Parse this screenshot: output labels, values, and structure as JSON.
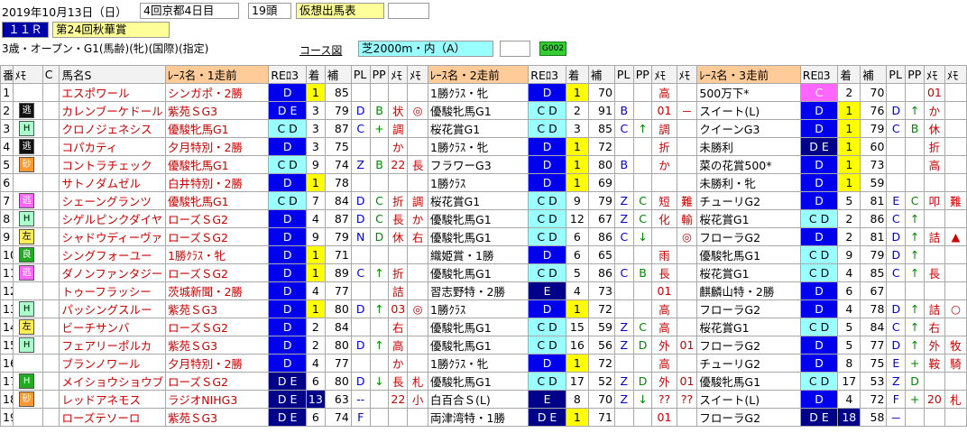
{
  "header": {
    "date": "2019年10月13日（日）",
    "meet": "4回京都4日目",
    "count": "19頭",
    "mode": "仮想出馬表",
    "race_no": "１１Ｒ",
    "race_name": "第24回秋華賞",
    "conditions": "3歳・オープン・G1(馬齢)(牝)(国際)(指定)",
    "course_label": "コース図",
    "course": "芝2000m・内（A）",
    "code": "G002"
  },
  "columns": [
    "番",
    "ﾒﾓ",
    "C",
    "馬名S",
    "ﾚｰｽ名・1走前",
    "REﾛ3",
    "着",
    "補",
    "PL",
    "PP",
    "ﾒﾓ",
    "ﾒﾓ",
    "ﾚｰｽ名・2走前",
    "REﾛ3",
    "着",
    "補",
    "PL",
    "PP",
    "ﾒﾓ",
    "ﾒﾓ",
    "ﾚｰｽ名・3走前",
    "REﾛ3",
    "着",
    "補",
    "PL",
    "PP",
    "ﾒﾓ",
    "ﾒﾓ"
  ],
  "rows": [
    {
      "n": "1",
      "b": "",
      "bc": "b-none",
      "name": "エスポワール",
      "c": [
        [
          "シンガポ・2勝",
          "D",
          "re-blue",
          "1",
          "ch-yel",
          "85",
          "",
          "",
          "",
          ""
        ],
        [
          "1勝ｸﾗｽ・牝",
          "D",
          "re-blue",
          "1",
          "ch-yel",
          "70",
          "",
          "",
          "高",
          ""
        ],
        [
          "500万下*",
          "C",
          "re-mag",
          "2",
          "",
          "70",
          "",
          "",
          "01",
          ""
        ]
      ]
    },
    {
      "n": "2",
      "b": "逃",
      "bc": "b-black",
      "name": "カレンブーケドール",
      "c": [
        [
          "紫苑ＳG3",
          "D E",
          "re-blue",
          "3",
          "",
          "79",
          "D",
          "B",
          "状",
          "◎"
        ],
        [
          "優駿牝馬G1",
          "C D",
          "re-cyan",
          "2",
          "",
          "91",
          "B",
          "",
          "01",
          "－"
        ],
        [
          "スイート(L)",
          "D",
          "re-blue",
          "1",
          "ch-yel",
          "76",
          "D",
          "↑",
          "か",
          ""
        ]
      ]
    },
    {
      "n": "3",
      "b": "H",
      "bc": "b-lt",
      "name": "クロノジェネシス",
      "c": [
        [
          "優駿牝馬G1",
          "C D",
          "re-cyan",
          "3",
          "",
          "87",
          "C",
          "+",
          "調",
          ""
        ],
        [
          "桜花賞G1",
          "C D",
          "re-cyan",
          "3",
          "",
          "85",
          "C",
          "↑",
          "調",
          ""
        ],
        [
          "クイーンG3",
          "D",
          "re-blue",
          "1",
          "ch-yel",
          "79",
          "C",
          "B",
          "休",
          ""
        ]
      ]
    },
    {
      "n": "4",
      "b": "逃",
      "bc": "b-black",
      "name": "コパカティ",
      "c": [
        [
          "夕月特別・2勝",
          "D",
          "re-blue",
          "3",
          "",
          "75",
          "",
          "",
          "か",
          ""
        ],
        [
          "1勝ｸﾗｽ・牝",
          "D",
          "re-blue",
          "1",
          "ch-yel",
          "72",
          "",
          "",
          "折",
          ""
        ],
        [
          "未勝利",
          "D E",
          "re-navy",
          "1",
          "ch-yel",
          "60",
          "",
          "",
          "折",
          ""
        ]
      ]
    },
    {
      "n": "5",
      "b": "砂",
      "bc": "b-org",
      "name": "コントラチェック",
      "c": [
        [
          "優駿牝馬G1",
          "C D",
          "re-cyan",
          "9",
          "",
          "74",
          "Z",
          "B",
          "22",
          "長"
        ],
        [
          "フラワーG3",
          "D",
          "re-blue",
          "1",
          "ch-yel",
          "80",
          "B",
          "",
          "か",
          ""
        ],
        [
          "菜の花賞500*",
          "D",
          "re-blue",
          "1",
          "ch-yel",
          "73",
          "",
          "",
          "高",
          ""
        ]
      ]
    },
    {
      "n": "6",
      "b": "",
      "bc": "b-none",
      "name": "サトノダムゼル",
      "c": [
        [
          "白井特別・2勝",
          "D",
          "re-blue",
          "1",
          "ch-yel",
          "78",
          "",
          "",
          "",
          ""
        ],
        [
          "1勝ｸﾗｽ",
          "D",
          "re-blue",
          "1",
          "ch-yel",
          "69",
          "",
          "",
          "",
          ""
        ],
        [
          "未勝利・牝",
          "D",
          "re-blue",
          "1",
          "ch-yel",
          "59",
          "",
          "",
          "",
          ""
        ]
      ]
    },
    {
      "n": "7",
      "b": "逃",
      "bc": "b-mag",
      "name": "シェーングランツ",
      "c": [
        [
          "優駿牝馬G1",
          "C D",
          "re-cyan",
          "7",
          "",
          "84",
          "D",
          "C",
          "折",
          "調"
        ],
        [
          "桜花賞G1",
          "C D",
          "re-cyan",
          "9",
          "",
          "79",
          "Z",
          "C",
          "短",
          "難"
        ],
        [
          "チューリG2",
          "D",
          "re-blue",
          "5",
          "",
          "81",
          "E",
          "C",
          "叩",
          "難"
        ]
      ]
    },
    {
      "n": "8",
      "b": "H",
      "bc": "b-lt",
      "name": "シゲルピンクダイヤ",
      "c": [
        [
          "ローズＳG2",
          "D",
          "re-blue",
          "4",
          "",
          "87",
          "D",
          "C",
          "長",
          "か"
        ],
        [
          "優駿牝馬G1",
          "C D",
          "re-cyan",
          "12",
          "",
          "67",
          "Z",
          "C",
          "化",
          "輸"
        ],
        [
          "桜花賞G1",
          "C D",
          "re-cyan",
          "2",
          "",
          "86",
          "C",
          "↑",
          "",
          ""
        ]
      ]
    },
    {
      "n": "9",
      "b": "左",
      "bc": "b-yel",
      "name": "シャドウディーヴァ",
      "c": [
        [
          "ローズＳG2",
          "D",
          "re-blue",
          "9",
          "",
          "79",
          "N",
          "D",
          "休",
          "右"
        ],
        [
          "優駿牝馬G1",
          "C D",
          "re-cyan",
          "6",
          "",
          "86",
          "C",
          "↓",
          "",
          "◎"
        ],
        [
          "フローラG2",
          "D",
          "re-blue",
          "2",
          "",
          "81",
          "D",
          "↑",
          "詰",
          "▲"
        ]
      ]
    },
    {
      "n": "10",
      "b": "良",
      "bc": "b-grn",
      "name": "シングフォーユー",
      "c": [
        [
          "1勝ｸﾗｽ・牝",
          "D",
          "re-blue",
          "1",
          "ch-yel",
          "71",
          "",
          "",
          "",
          ""
        ],
        [
          "織姫賞・1勝",
          "D",
          "re-blue",
          "6",
          "",
          "65",
          "",
          "",
          "雨",
          ""
        ],
        [
          "優駿牝馬G1",
          "C D",
          "re-cyan",
          "9",
          "",
          "79",
          "D",
          "↑",
          "",
          ""
        ]
      ]
    },
    {
      "n": "11",
      "b": "逃",
      "bc": "b-mag",
      "name": "ダノンファンタジー",
      "c": [
        [
          "ローズＳG2",
          "D",
          "re-blue",
          "1",
          "ch-yel",
          "89",
          "C",
          "↑",
          "折",
          ""
        ],
        [
          "優駿牝馬G1",
          "C D",
          "re-cyan",
          "5",
          "",
          "86",
          "C",
          "B",
          "長",
          ""
        ],
        [
          "桜花賞G1",
          "C D",
          "re-cyan",
          "4",
          "",
          "85",
          "C",
          "↑",
          "長",
          ""
        ]
      ]
    },
    {
      "n": "12",
      "b": "",
      "bc": "b-none",
      "name": "トゥーフラッシー",
      "c": [
        [
          "茨城新聞・2勝",
          "D",
          "re-blue",
          "4",
          "",
          "77",
          "",
          "",
          "詰",
          ""
        ],
        [
          "習志野特・2勝",
          "E",
          "re-navy",
          "4",
          "",
          "73",
          "",
          "",
          "01",
          ""
        ],
        [
          "麒麟山特・2勝",
          "D",
          "re-blue",
          "6",
          "",
          "67",
          "",
          "",
          "",
          ""
        ]
      ]
    },
    {
      "n": "13",
      "b": "H",
      "bc": "b-lt",
      "name": "パッシングスルー",
      "c": [
        [
          "紫苑ＳG3",
          "D",
          "re-blue",
          "1",
          "ch-yel",
          "80",
          "D",
          "↑",
          "03",
          "◎"
        ],
        [
          "1勝ｸﾗｽ",
          "D",
          "re-blue",
          "1",
          "ch-yel",
          "72",
          "",
          "",
          "高",
          ""
        ],
        [
          "フローラG2",
          "D",
          "re-blue",
          "4",
          "",
          "78",
          "D",
          "↑",
          "詰",
          "○"
        ]
      ]
    },
    {
      "n": "14",
      "b": "左",
      "bc": "b-yel",
      "name": "ビーチサンバ",
      "c": [
        [
          "ローズＳG2",
          "D",
          "re-blue",
          "2",
          "",
          "84",
          "",
          "",
          "右",
          ""
        ],
        [
          "優駿牝馬G1",
          "C D",
          "re-cyan",
          "15",
          "",
          "59",
          "Z",
          "C",
          "高",
          ""
        ],
        [
          "桜花賞G1",
          "C D",
          "re-cyan",
          "5",
          "",
          "84",
          "C",
          "↑",
          "右",
          ""
        ]
      ]
    },
    {
      "n": "15",
      "b": "H",
      "bc": "b-lt",
      "name": "フェアリーポルカ",
      "c": [
        [
          "紫苑ＳG3",
          "D",
          "re-blue",
          "2",
          "",
          "80",
          "D",
          "↑",
          "高",
          ""
        ],
        [
          "優駿牝馬G1",
          "C D",
          "re-cyan",
          "16",
          "",
          "56",
          "Z",
          "D",
          "外",
          "01"
        ],
        [
          "フローラG2",
          "D",
          "re-blue",
          "5",
          "",
          "77",
          "D",
          "↑",
          "外",
          "牧"
        ]
      ]
    },
    {
      "n": "16",
      "b": "",
      "bc": "b-none",
      "name": "ブランノワール",
      "c": [
        [
          "夕月特別・2勝",
          "D",
          "re-blue",
          "4",
          "",
          "77",
          "",
          "",
          "か",
          ""
        ],
        [
          "1勝ｸﾗｽ・牝",
          "D",
          "re-blue",
          "1",
          "ch-yel",
          "72",
          "",
          "",
          "高",
          ""
        ],
        [
          "チューリG2",
          "D",
          "re-blue",
          "8",
          "",
          "75",
          "E",
          "+",
          "鞍",
          "騎"
        ]
      ]
    },
    {
      "n": "17",
      "b": "H",
      "bc": "b-grn",
      "name": "メイショウショウブ",
      "c": [
        [
          "ローズＳG2",
          "D E",
          "re-navy",
          "6",
          "",
          "80",
          "D",
          "↓",
          "長",
          "札"
        ],
        [
          "優駿牝馬G1",
          "C D",
          "re-cyan",
          "17",
          "",
          "52",
          "Z",
          "D",
          "外",
          "01"
        ],
        [
          "優駿牝馬G1",
          "C D",
          "re-cyan",
          "17",
          "",
          "53",
          "Z",
          "D",
          "",
          ""
        ]
      ]
    },
    {
      "n": "18",
      "b": "砂",
      "bc": "b-org",
      "name": "レッドアネモス",
      "c": [
        [
          "ラジオNIHG3",
          "D E",
          "re-navy",
          "13",
          "ch-navy",
          "63",
          "--",
          "",
          "22",
          "小"
        ],
        [
          "白百合Ｓ(L)",
          "E",
          "re-navy",
          "8",
          "",
          "70",
          "Z",
          "↓",
          "??",
          "??"
        ],
        [
          "スイート(L)",
          "D",
          "re-blue",
          "4",
          "",
          "72",
          "F",
          "+",
          "20",
          "札"
        ]
      ]
    },
    {
      "n": "19",
      "b": "",
      "bc": "b-none",
      "name": "ローズテソーロ",
      "c": [
        [
          "紫苑ＳG3",
          "D E",
          "re-navy",
          "6",
          "",
          "74",
          "F",
          "",
          "",
          ""
        ],
        [
          "両津湾特・1勝",
          "D E",
          "re-navy",
          "1",
          "ch-yel",
          "71",
          "",
          "",
          "01",
          ""
        ],
        [
          "フローラG2",
          "D E",
          "re-navy",
          "18",
          "ch-navy",
          "58",
          "－",
          "",
          "",
          ""
        ]
      ]
    }
  ]
}
